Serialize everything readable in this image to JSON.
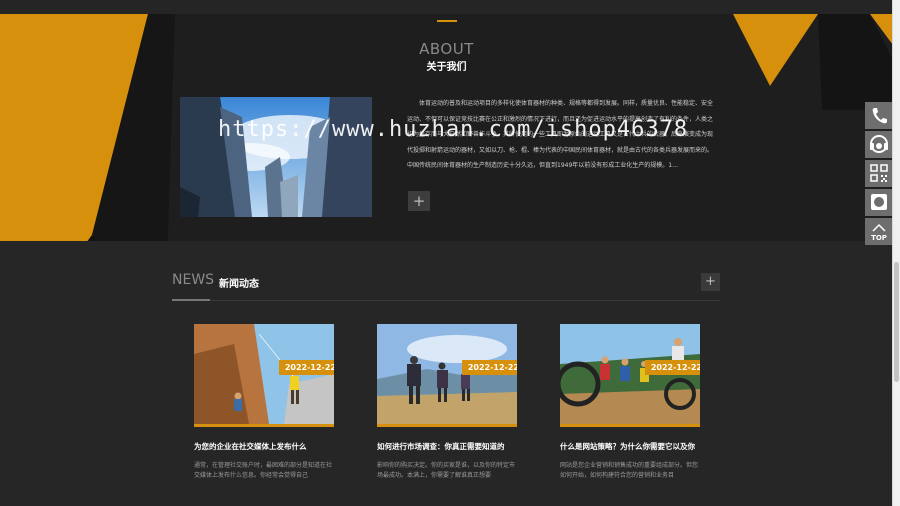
{
  "about": {
    "title_en": "ABOUT",
    "title_cn": "关于我们",
    "body": "体育运动的普及和运动项目的多样化使体育器材的种类、规格等都得到发展。同样，质量优良、性能稳定、安全运动、不但可以保证竞技比赛在公正和激烈的情况下进行，而且还为促进运动水平的提高创造了有利的条件，人类之初为生存而与大自然和野兽作斗争，其所使用的一些工具即为原始的运动工具又是古代士兵的武器。后来演变成为现代投掷和射箭运动的器材，又如以刀、枪、棍、棒为代表的中国民间体育器材，就是由古代的各类兵器发展而来的。中国传统民间体育器材的生产制造历史十分久远，但直到1949年以前没有形成工业化生产的规模。1…",
    "more_label": "+"
  },
  "watermark": "https://www.huzhan.com/ishop46378",
  "news": {
    "title_en": "NEWS",
    "title_cn": "新闻动态",
    "more_label": "+",
    "items": [
      {
        "date": "2022-12-22",
        "title": "为您的企业在社交媒体上发布什么",
        "desc": "通常，在管理社交账户时，最困难的部分是知道在社交媒体上发布什么信息。你经常会觉得自己"
      },
      {
        "date": "2022-12-22",
        "title": "如何进行市场调查：你真正需要知道的",
        "desc": "影响你的购买决定。你的买家是谁，以及你的特定市场最成功。本满上，你需要了解谁真正想要"
      },
      {
        "date": "2022-12-22",
        "title": "什么是网站策略？为什么你需要它以及你",
        "desc": "网站是您企业营销和销售成功的重要组成部分。但您如何开始，如何构建符合您的营销和业务目"
      }
    ]
  },
  "sidebar": {
    "items": [
      {
        "icon": "phone-icon"
      },
      {
        "icon": "headset-icon"
      },
      {
        "icon": "qrcode-icon"
      },
      {
        "icon": "weixin-icon"
      },
      {
        "icon": "back-to-top-icon",
        "label": "TOP"
      }
    ]
  },
  "colors": {
    "accent": "#d6900b",
    "background": "#1e1e1e",
    "news_band": "#262626",
    "sidebar": "#6e6e6e"
  }
}
